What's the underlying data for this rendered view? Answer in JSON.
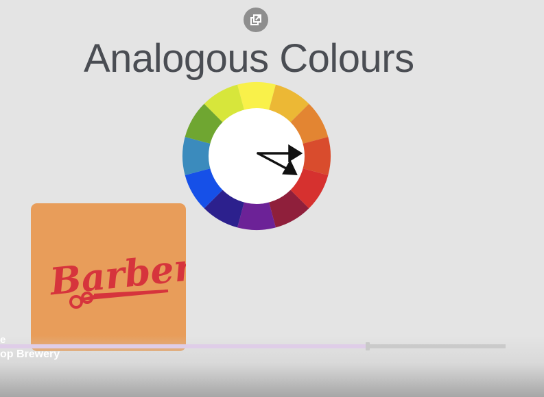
{
  "slide": {
    "title": "Analogous Colours"
  },
  "color_wheel": {
    "segments": [
      "#f9f14a",
      "#ecb835",
      "#e38532",
      "#d94c2d",
      "#d6312f",
      "#8f1f3b",
      "#6c2297",
      "#2c208d",
      "#1650e8",
      "#3b8bbd",
      "#6fa631",
      "#d7e63b"
    ]
  },
  "logo": {
    "text": "Barber",
    "text_color": "#d6343c",
    "background": "#e89d5a"
  },
  "video_overlay": {
    "line1": "e",
    "line2": "op Brewery",
    "progress_fraction": 0.727
  },
  "icons": {
    "popout": "external-window-icon"
  }
}
